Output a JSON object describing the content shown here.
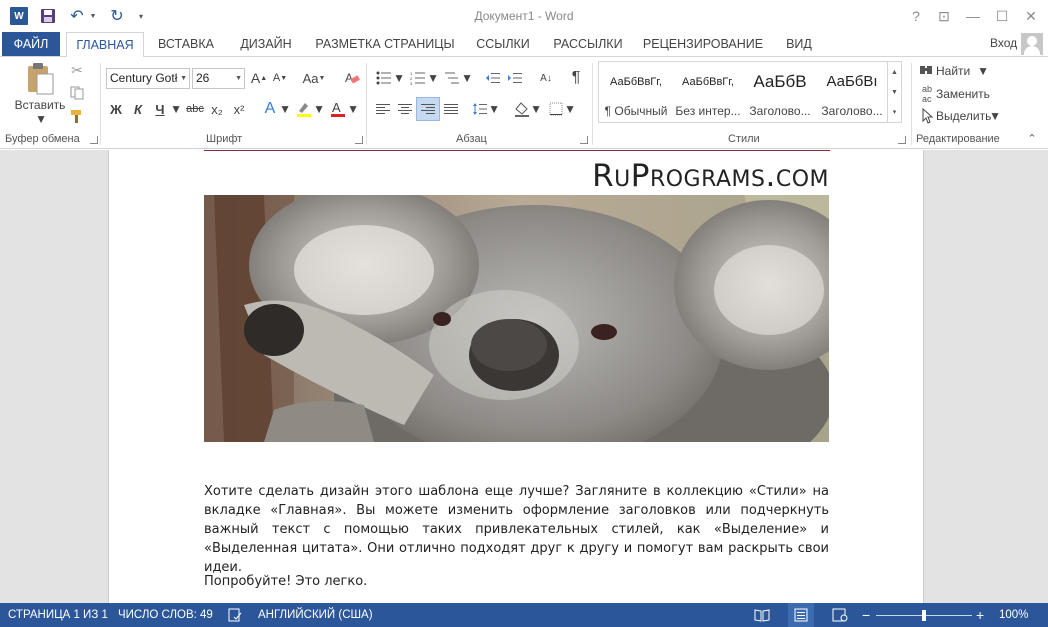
{
  "titlebar": {
    "title": "Документ1 - Word",
    "help": "?",
    "ribbon_display": "⊡",
    "minimize": "—",
    "maximize": "☐",
    "close": "✕"
  },
  "tabs": {
    "file": "ФАЙЛ",
    "items": [
      "ГЛАВНАЯ",
      "ВСТАВКА",
      "ДИЗАЙН",
      "РАЗМЕТКА СТРАНИЦЫ",
      "ССЫЛКИ",
      "РАССЫЛКИ",
      "РЕЦЕНЗИРОВАНИЕ",
      "ВИД"
    ],
    "active": "ГЛАВНАЯ",
    "signin": "Вход"
  },
  "ribbon": {
    "clipboard": {
      "paste_label": "Вставить",
      "group_label": "Буфер обмена"
    },
    "font": {
      "font_name": "Century Gotł",
      "font_size": "26",
      "bold": "Ж",
      "italic": "К",
      "underline": "Ч",
      "strikethrough": "abc",
      "subscript": "x₂",
      "superscript": "x²",
      "case": "Aa",
      "grow": "A",
      "shrink": "A",
      "group_label": "Шрифт"
    },
    "paragraph": {
      "group_label": "Абзац",
      "pilcrow": "¶"
    },
    "styles": {
      "group_label": "Стили",
      "items": [
        {
          "preview": "АаБбВвГг,",
          "name": "¶ Обычный"
        },
        {
          "preview": "АаБбВвГг,",
          "name": "Без интер..."
        },
        {
          "preview": "АаБбВ",
          "name": "Заголово..."
        },
        {
          "preview": "АаБбВı",
          "name": "Заголово..."
        }
      ]
    },
    "editing": {
      "find": "Найти",
      "replace": "Заменить",
      "select": "Выделить",
      "group_label": "Редактирование"
    }
  },
  "document": {
    "header_brand": "RuPrograms.com",
    "paragraph1": "Хотите сделать дизайн этого шаблона еще лучше? Загляните в коллекцию «Стили» на вкладке «Главная». Вы можете изменить оформление заголовков или подчеркнуть важный текст с помощью таких привлекательных стилей, как «Выделение» и «Выделенная цитата». Они отлично подходят друг к другу и помогут вам раскрыть свои идеи.",
    "paragraph2": "Попробуйте! Это легко."
  },
  "statusbar": {
    "page": "СТРАНИЦА 1 ИЗ 1",
    "words": "ЧИСЛО СЛОВ: 49",
    "language": "АНГЛИЙСКИЙ (США)",
    "zoom": "100%",
    "zoom_level": 1.0
  },
  "colors": {
    "accent": "#2b579a",
    "highlight": "#ffff00",
    "font_color": "#e02020",
    "header_line": "#8a2d3b"
  }
}
